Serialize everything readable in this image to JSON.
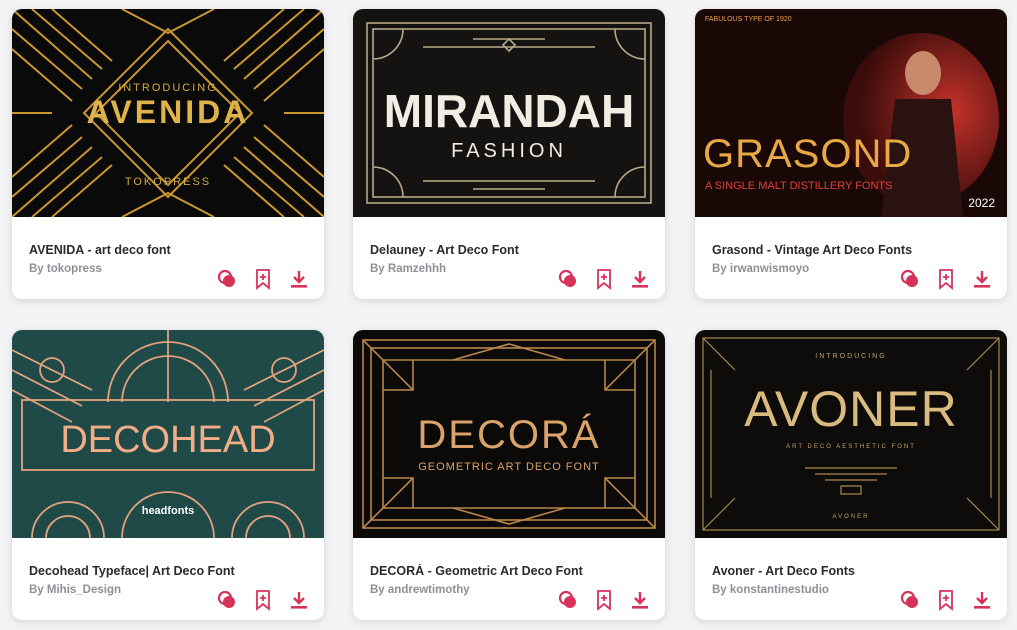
{
  "theme": {
    "accent": "#d6335a",
    "card_bg": "#ffffff",
    "page_bg": "#f3f3f5",
    "title_color": "#2b2b2b",
    "author_color": "#8f8f95"
  },
  "actions": {
    "compare_icon": "compare-icon",
    "bookmark_icon": "bookmark-add-icon",
    "download_icon": "download-icon"
  },
  "cards": [
    {
      "title": "AVENIDA - art deco font",
      "author": "By tokopress",
      "preview": {
        "top": "INTRODUCING",
        "main": "AVENIDA",
        "bottom": "TOKOPRESS"
      }
    },
    {
      "title": "Delauney - Art Deco Font",
      "author": "By Ramzehhh",
      "preview": {
        "main": "MIRANDAH",
        "sub": "FASHION"
      }
    },
    {
      "title": "Grasond - Vintage Art Deco Fonts",
      "author": "By irwanwismoyo",
      "preview": {
        "top": "FABULOUS TYPE OF 1920",
        "main": "GRASOND",
        "sub": "A SINGLE MALT DISTILLERY FONTS",
        "year": "2022"
      }
    },
    {
      "title": "Decohead Typeface| Art Deco Font",
      "author": "By Mihis_Design",
      "preview": {
        "main": "DECOHEAD",
        "sub": "headfonts"
      }
    },
    {
      "title": "DECORÁ - Geometric Art Deco Font",
      "author": "By andrewtimothy",
      "preview": {
        "main": "DECORÁ",
        "sub": "GEOMETRIC ART DECO FONT"
      }
    },
    {
      "title": "Avoner - Art Deco Fonts",
      "author": "By konstantinestudio",
      "preview": {
        "top": "INTRODUCING",
        "main": "AVONER",
        "sub": "ART DECO AESTHETIC FONT",
        "bottom": "AVONER"
      }
    }
  ]
}
